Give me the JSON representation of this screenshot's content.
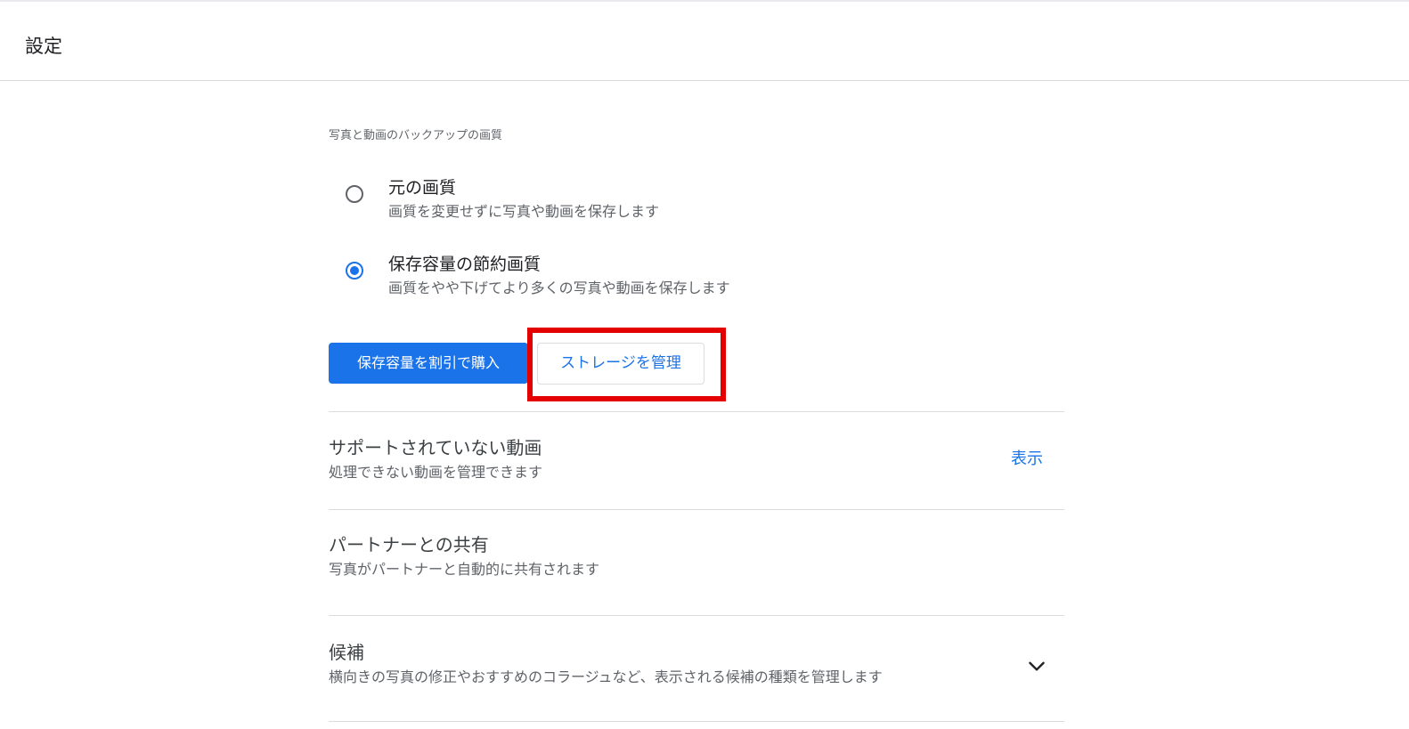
{
  "header": {
    "title": "設定"
  },
  "backup_quality": {
    "section_label": "写真と動画のバックアップの画質",
    "options": [
      {
        "title": "元の画質",
        "description": "画質を変更せずに写真や動画を保存します",
        "selected": false
      },
      {
        "title": "保存容量の節約画質",
        "description": "画質をやや下げてより多くの写真や動画を保存します",
        "selected": true
      }
    ],
    "buy_storage_label": "保存容量を割引で購入",
    "manage_storage_label": "ストレージを管理"
  },
  "settings": {
    "unsupported_videos": {
      "title": "サポートされていない動画",
      "description": "処理できない動画を管理できます",
      "action_label": "表示"
    },
    "partner_sharing": {
      "title": "パートナーとの共有",
      "description": "写真がパートナーと自動的に共有されます"
    },
    "suggestions": {
      "title": "候補",
      "description": "横向きの写真の修正やおすすめのコラージュなど、表示される候補の種類を管理します",
      "icon": "chevron-down-icon"
    }
  },
  "colors": {
    "accent": "#1a73e8",
    "highlight": "#e50000",
    "divider": "#dadce0"
  }
}
